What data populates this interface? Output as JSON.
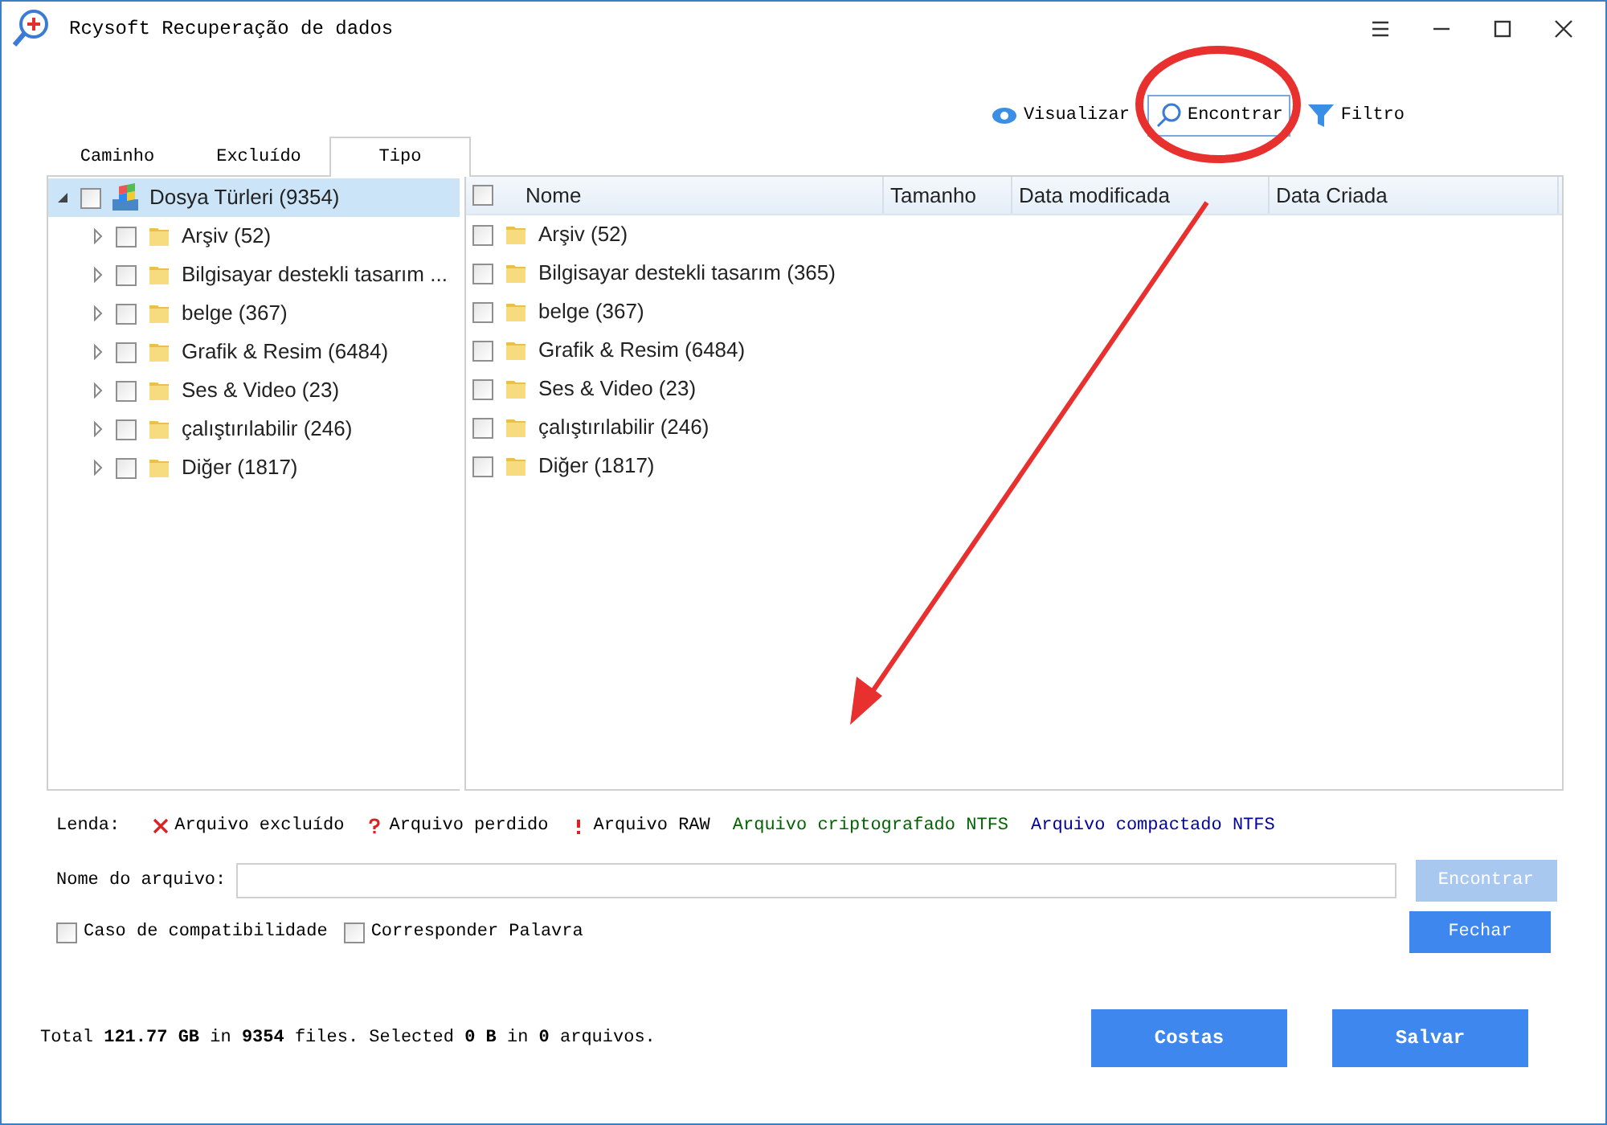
{
  "window": {
    "title": "Rcysoft Recuperação de dados"
  },
  "toolbar": [
    {
      "kind": "view",
      "label": "Visualizar",
      "selected": false
    },
    {
      "kind": "find",
      "label": "Encontrar",
      "selected": true
    },
    {
      "kind": "filter",
      "label": "Filtro",
      "selected": false
    }
  ],
  "tabs": [
    {
      "label": "Caminho",
      "selected": false
    },
    {
      "label": "Excluído",
      "selected": false
    },
    {
      "label": "Tipo",
      "selected": true
    }
  ],
  "tree": {
    "label": "Dosya Türleri (9354)",
    "checked": false,
    "expanded": true,
    "selected": true,
    "children": [
      {
        "label": "Arşiv (52)",
        "checked": false,
        "expanded": false,
        "selected": false
      },
      {
        "label": "Bilgisayar destekli tasarım ...",
        "checked": false,
        "expanded": false,
        "selected": false
      },
      {
        "label": "belge (367)",
        "checked": false,
        "expanded": false,
        "selected": false
      },
      {
        "label": "Grafik & Resim (6484)",
        "checked": false,
        "expanded": false,
        "selected": false
      },
      {
        "label": "Ses & Video (23)",
        "checked": false,
        "expanded": false,
        "selected": false
      },
      {
        "label": "çalıştırılabilir (246)",
        "checked": false,
        "expanded": false,
        "selected": false
      },
      {
        "label": "Diğer (1817)",
        "checked": false,
        "expanded": false,
        "selected": false
      }
    ]
  },
  "table": {
    "header_checked": false,
    "columns": [
      "Nome",
      "Tamanho",
      "Data modificada",
      "Data Criada"
    ],
    "rows": [
      {
        "name": "Arşiv (52)",
        "checked": false
      },
      {
        "name": "Bilgisayar destekli tasarım (365)",
        "checked": false
      },
      {
        "name": "belge (367)",
        "checked": false
      },
      {
        "name": "Grafik & Resim (6484)",
        "checked": false
      },
      {
        "name": "Ses & Video (23)",
        "checked": false
      },
      {
        "name": "çalıştırılabilir (246)",
        "checked": false
      },
      {
        "name": "Diğer (1817)",
        "checked": false
      }
    ]
  },
  "legend": {
    "label": "Lenda:",
    "items": [
      {
        "kind": "deleted",
        "text": "Arquivo excluído"
      },
      {
        "kind": "lost",
        "text": "Arquivo perdido"
      },
      {
        "kind": "raw",
        "text": "Arquivo RAW"
      },
      {
        "kind": "plain",
        "text": "Arquivo criptografado NTFS",
        "color": "#006400"
      },
      {
        "kind": "plain",
        "text": "Arquivo compactado NTFS",
        "color": "#0000a0"
      }
    ]
  },
  "file_name": {
    "label": "Nome do arquivo:"
  },
  "find_button": {
    "label": "Encontrar",
    "disabled": true
  },
  "close_button": {
    "label": "Fechar",
    "disabled": false
  },
  "options": [
    {
      "label": "Caso de compatibilidade",
      "checked": false
    },
    {
      "label": "Corresponder Palavra",
      "checked": false
    }
  ],
  "status": "Total **121.77 GB** in **9354** files. Selected **0 B** in **0** arquivos.",
  "buttons": [
    "Costas",
    "Salvar"
  ]
}
